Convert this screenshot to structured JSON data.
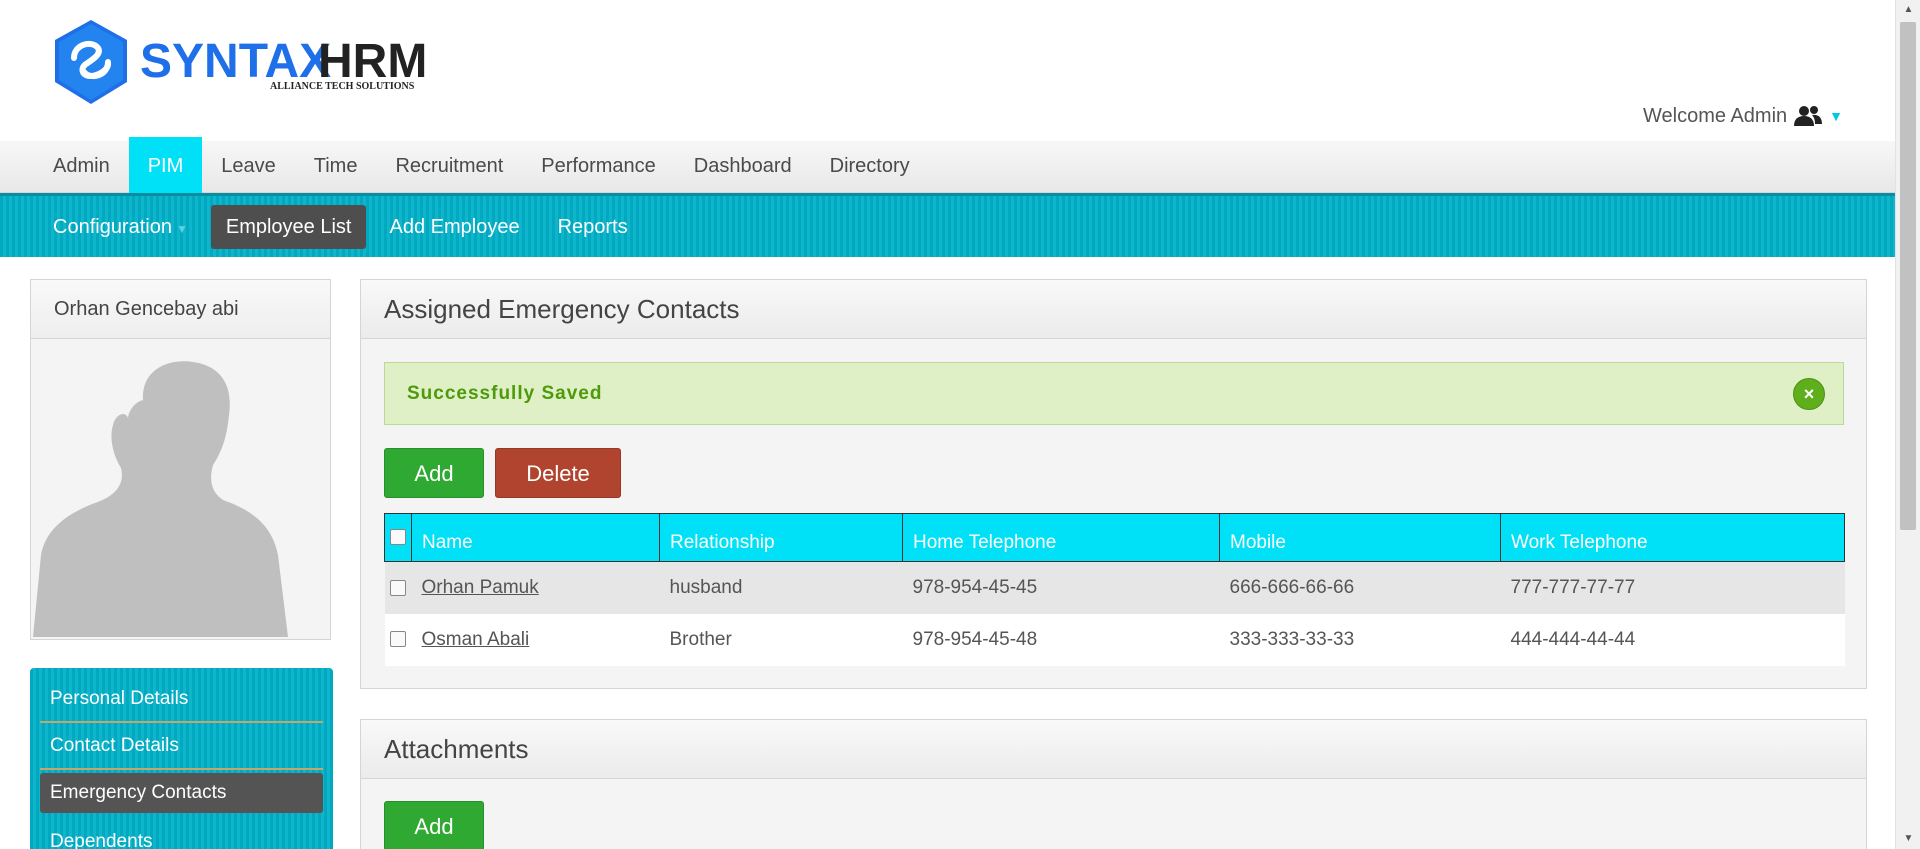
{
  "brand": {
    "name_part1": "SYNTAX",
    "name_part2": "HRM",
    "tagline": "ALLIANCE TECH SOLUTIONS",
    "colors": {
      "primary": "#1e6fe8",
      "dark": "#222222",
      "accent": "#00e1f7"
    }
  },
  "header": {
    "welcome": "Welcome Admin"
  },
  "topnav": {
    "items": [
      {
        "label": "Admin"
      },
      {
        "label": "PIM",
        "active": true
      },
      {
        "label": "Leave"
      },
      {
        "label": "Time"
      },
      {
        "label": "Recruitment"
      },
      {
        "label": "Performance"
      },
      {
        "label": "Dashboard"
      },
      {
        "label": "Directory"
      }
    ]
  },
  "subnav": {
    "items": [
      {
        "label": "Configuration"
      },
      {
        "label": "Employee List",
        "active": true
      },
      {
        "label": "Add Employee"
      },
      {
        "label": "Reports"
      }
    ]
  },
  "profile": {
    "name": "Orhan Gencebay abi"
  },
  "sidemenu": {
    "items": [
      {
        "label": "Personal Details"
      },
      {
        "label": "Contact Details"
      },
      {
        "label": "Emergency Contacts",
        "active": true
      },
      {
        "label": "Dependents"
      }
    ]
  },
  "contacts": {
    "title": "Assigned Emergency Contacts",
    "alert": "Successfully Saved",
    "close": "×",
    "add_label": "Add",
    "delete_label": "Delete",
    "columns": [
      "Name",
      "Relationship",
      "Home Telephone",
      "Mobile",
      "Work Telephone"
    ],
    "rows": [
      {
        "name": "Orhan Pamuk",
        "relationship": "husband",
        "home": "978-954-45-45",
        "mobile": "666-666-66-66",
        "work": "777-777-77-77"
      },
      {
        "name": "Osman Abali",
        "relationship": "Brother",
        "home": "978-954-45-48",
        "mobile": "333-333-33-33",
        "work": "444-444-44-44"
      }
    ]
  },
  "attachments": {
    "title": "Attachments",
    "add_label": "Add"
  }
}
